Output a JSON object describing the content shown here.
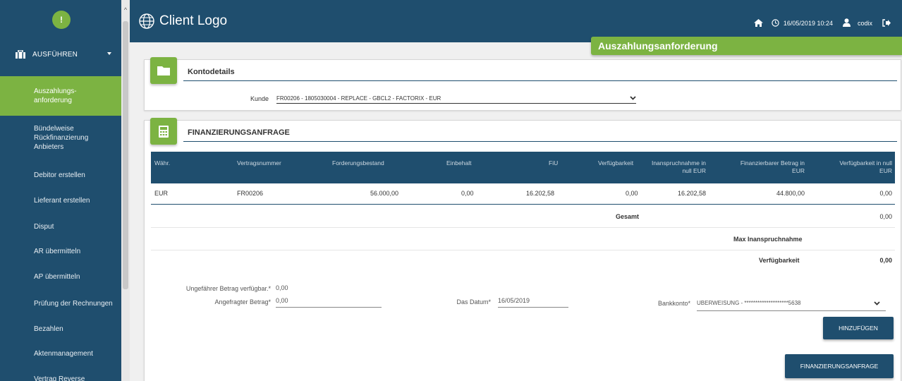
{
  "sidebar": {
    "avatar_letter": "!",
    "section_label": "AUSFÜHREN",
    "items": [
      {
        "label": "Auszahlungs-\nanforderung"
      },
      {
        "label": "Bündelweise Rückfinanzierung Anbieters"
      },
      {
        "label": "Debitor erstellen"
      },
      {
        "label": "Lieferant erstellen"
      },
      {
        "label": "Disput"
      },
      {
        "label": "AR übermitteln"
      },
      {
        "label": "AP übermitteln"
      },
      {
        "label": "Prüfung der Rechnungen"
      },
      {
        "label": "Bezahlen"
      },
      {
        "label": "Aktenmanagement"
      },
      {
        "label": "Vertrag Reverse"
      }
    ]
  },
  "header": {
    "logo_text": "Client Logo",
    "datetime": "16/05/2019 10:24",
    "username": "codix",
    "icons": [
      "home-icon",
      "clock-icon",
      "user-icon",
      "logout-icon"
    ]
  },
  "page_title": "Auszahlungsanforderung",
  "kontodetails": {
    "title": "Kontodetails",
    "kunde_label": "Kunde",
    "kunde_value": "FR00206 - 1805030004 - REPLACE - GBCL2 - FACTORIX - EUR"
  },
  "finanzierung": {
    "title": "FINANZIERUNGSANFRAGE",
    "columns": [
      "Währ.",
      "Vertragsnummer",
      "Forderungsbestand",
      "Einbehalt",
      "FiU",
      "Verfügbarkeit",
      "Inanspruchnahme in null EUR",
      "Finanzierbarer Betrag in EUR",
      "Verfügbarkeit in null EUR"
    ],
    "col_lines": {
      "c7a": "Inanspruchnahme in",
      "c7b": "null EUR",
      "c8a": "Finanzierbarer Betrag in",
      "c8b": "EUR",
      "c9a": "Verfügbarkeit in null",
      "c9b": "EUR"
    },
    "row": {
      "waehr": "EUR",
      "vertrag": "FR00206",
      "forderung": "56.000,00",
      "einbehalt": "0,00",
      "fiu": "16.202,58",
      "verfueg": "0,00",
      "inanspruch": "16.202,58",
      "finanzierbar": "44.800,00",
      "verfueg_null": "0,00"
    },
    "gesamt_label": "Gesamt",
    "gesamt_value": "0,00",
    "max_label": "Max Inanspruchnahme",
    "verfueg_label": "Verfügbarkeit",
    "verfueg_value": "0,00"
  },
  "form": {
    "ungefaehr_label": "Ungefährer Betrag verfügbar.*",
    "ungefaehr_value": "0,00",
    "angefragt_label": "Angefragter Betrag*",
    "angefragt_value": "0,00",
    "datum_label": "Das Datum*",
    "datum_value": "16/05/2019",
    "bank_label": "Bankkonto*",
    "bank_value": "UBERWEISUNG - ********************5638",
    "add_button": "HINZUFÜGEN",
    "submit_button": "FINANZIERUNGSANFRAGE"
  },
  "colors": {
    "primary": "#1f4e6e",
    "accent": "#7cb342"
  }
}
